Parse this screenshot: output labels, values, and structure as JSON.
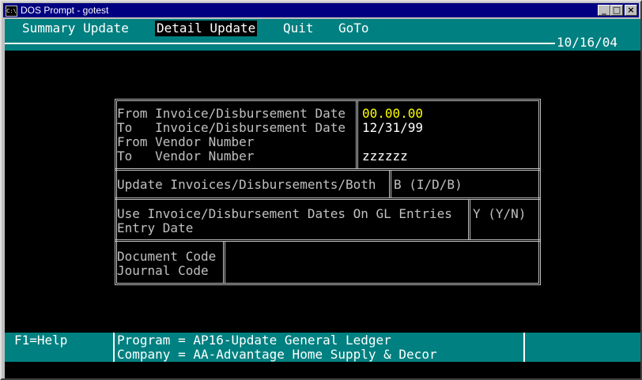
{
  "window": {
    "title": "DOS Prompt - gotest",
    "icon_text": "C:\\",
    "controls": {
      "minimize": "_",
      "maximize": "□",
      "close": "×"
    }
  },
  "menu": {
    "items": [
      "Summary Update",
      "Detail Update",
      "Quit",
      "GoTo"
    ],
    "active_index": 1
  },
  "header": {
    "date": "10/16/04"
  },
  "form": {
    "from_date_label": "From Invoice/Disbursement Date",
    "from_date_value": "00.00.00",
    "to_date_label": "To   Invoice/Disbursement Date",
    "to_date_value": "12/31/99",
    "from_vendor_label": "From Vendor Number",
    "from_vendor_value": "",
    "to_vendor_label": "To   Vendor Number",
    "to_vendor_value": "zzzzzz",
    "update_label": "Update Invoices/Disbursements/Both",
    "update_value": "B (I/D/B)",
    "use_dates_label": "Use Invoice/Disbursement Dates On GL Entries",
    "use_dates_value": "Y (Y/N)",
    "entry_date_label": "Entry Date",
    "document_code_label": "Document Code",
    "journal_code_label": "Journal Code"
  },
  "status": {
    "help": "F1=Help",
    "program": "Program = AP16-Update General Ledger",
    "company": "Company = AA-Advantage Home Supply & Decor"
  }
}
